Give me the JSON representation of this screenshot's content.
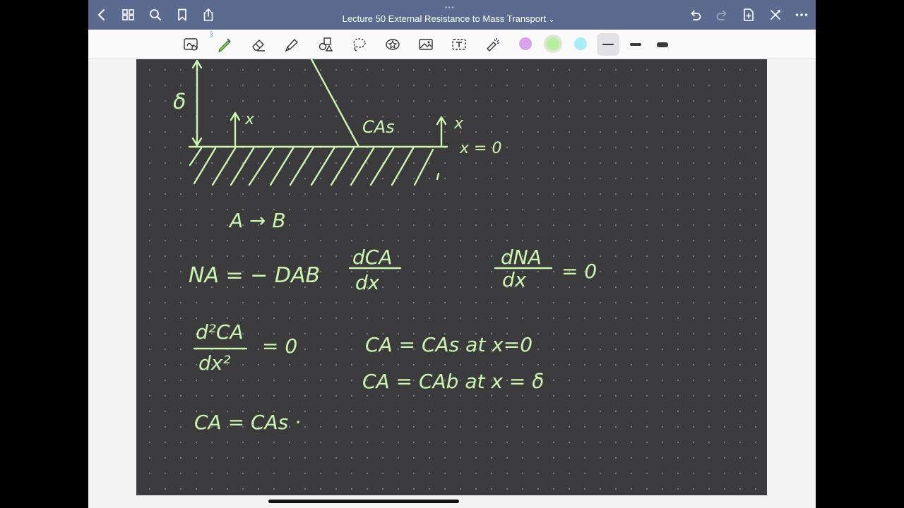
{
  "window": {
    "title": "Lecture 50 External Resistance to Mass Transport",
    "title_chevron": "⌄",
    "grabber": "•••"
  },
  "titlebar_left_icons": [
    "back-icon",
    "grid-icon",
    "search-icon",
    "bookmark-icon",
    "share-icon"
  ],
  "titlebar_right_icons": [
    "undo-icon",
    "redo-icon",
    "add-page-icon",
    "close-x-icon",
    "more-icon"
  ],
  "toolbar": {
    "tools": [
      "lasso-read-icon",
      "pen-icon",
      "eraser-icon",
      "highlighter-icon",
      "shapes-icon",
      "lasso-icon",
      "sticker-icon",
      "image-icon",
      "text-box-icon",
      "laser-pointer-icon"
    ],
    "swatches": [
      "#d8a3ec",
      "#b6f09c",
      "#a8ecf8"
    ],
    "selected_swatch": "#b6f09c",
    "stroke_widths": [
      "thin",
      "medium",
      "thick"
    ],
    "selected_stroke": "thin"
  },
  "notes": {
    "delta": "δ",
    "x_left": "x",
    "x_right": "x",
    "c_as_label": "CAs",
    "x_eq_0": "x = 0",
    "reaction": "A → B",
    "eq1_lhs": "NA  =  − DAB",
    "eq1_num": "dCA",
    "eq1_den": "dx",
    "eq2_num": "dNA",
    "eq2_den": "dx",
    "eq2_rhs": "=  0",
    "eq3_num": "d²CA",
    "eq3_den": "dx²",
    "eq3_rhs": "=  0",
    "bc1": "CA = CAs   at   x=0",
    "bc2": "CA = CAb   at   x = δ",
    "eq4": "CA  =  CAs ·"
  }
}
